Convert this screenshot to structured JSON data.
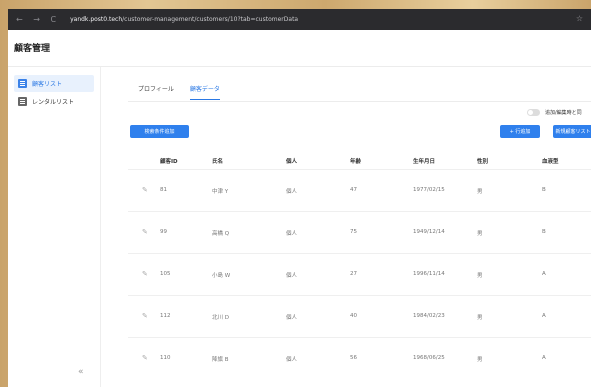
{
  "browser": {
    "nav_back": "←",
    "nav_forward": "→",
    "nav_reload": "C",
    "url_host": "yandk.post0.tech",
    "url_path": "/customer-management/customers/10?tab=customerData"
  },
  "app": {
    "title": "顧客管理"
  },
  "sidebar": {
    "items": [
      {
        "label": "顧客リスト",
        "active": true
      },
      {
        "label": "レンタルリスト",
        "active": false
      }
    ],
    "collapse_glyph": "«"
  },
  "main": {
    "tabs": [
      {
        "label": "プロフィール",
        "active": false
      },
      {
        "label": "顧客データ",
        "active": true
      }
    ],
    "toggle_label": "追加/編集時と同",
    "buttons": {
      "add_condition": "検索条件追加",
      "add_row": "+ 行追加",
      "new_customer": "新規顧客リスト"
    },
    "table": {
      "columns": [
        "顧客ID",
        "氏名",
        "個人",
        "年齢",
        "生年月日",
        "性別",
        "血液型"
      ],
      "rows": [
        [
          "81",
          "中津 Y",
          "個人",
          "47",
          "1977/02/15",
          "男",
          "B"
        ],
        [
          "99",
          "高橋 Q",
          "個人",
          "75",
          "1949/12/14",
          "男",
          "B"
        ],
        [
          "105",
          "小島 W",
          "個人",
          "27",
          "1996/11/14",
          "男",
          "A"
        ],
        [
          "112",
          "北川 D",
          "個人",
          "40",
          "1984/02/23",
          "男",
          "A"
        ],
        [
          "110",
          "降旗 B",
          "個人",
          "56",
          "1968/06/25",
          "男",
          "A"
        ]
      ]
    }
  },
  "colors": {
    "accent": "#2f80ed",
    "sidebar_active_bg": "#e8f1fd",
    "chrome": "#2b2b2e"
  }
}
